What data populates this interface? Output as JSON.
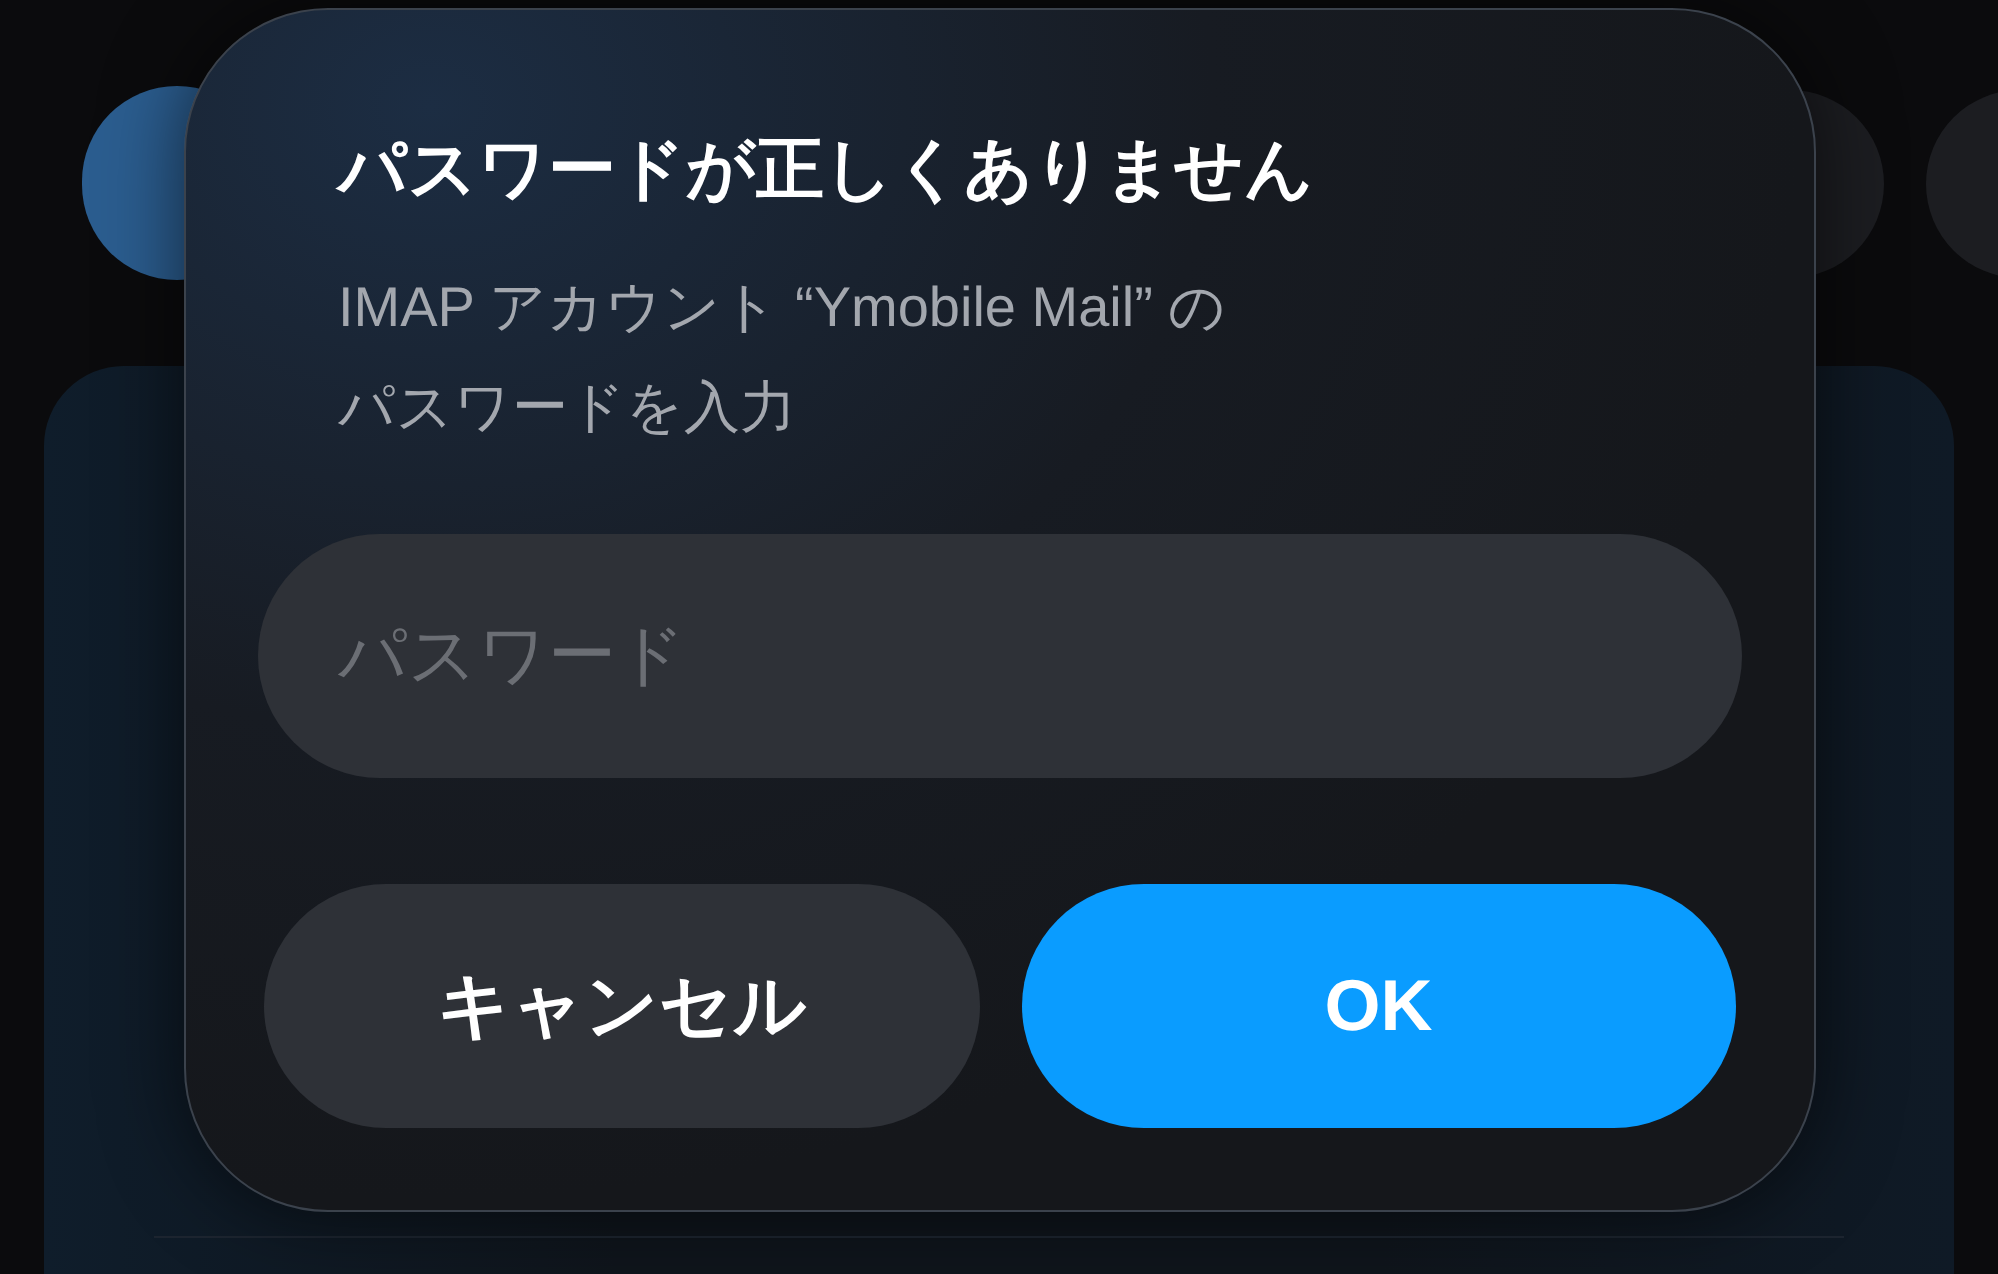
{
  "dialog": {
    "title": "パスワードが正しくありません",
    "message": "IMAP アカウント “Ymobile Mail” のパスワードを入力",
    "password_field": {
      "placeholder": "パスワード"
    },
    "buttons": [
      {
        "label": "キャンセル",
        "kind": "cancel"
      },
      {
        "label": "OK",
        "kind": "default"
      }
    ]
  }
}
